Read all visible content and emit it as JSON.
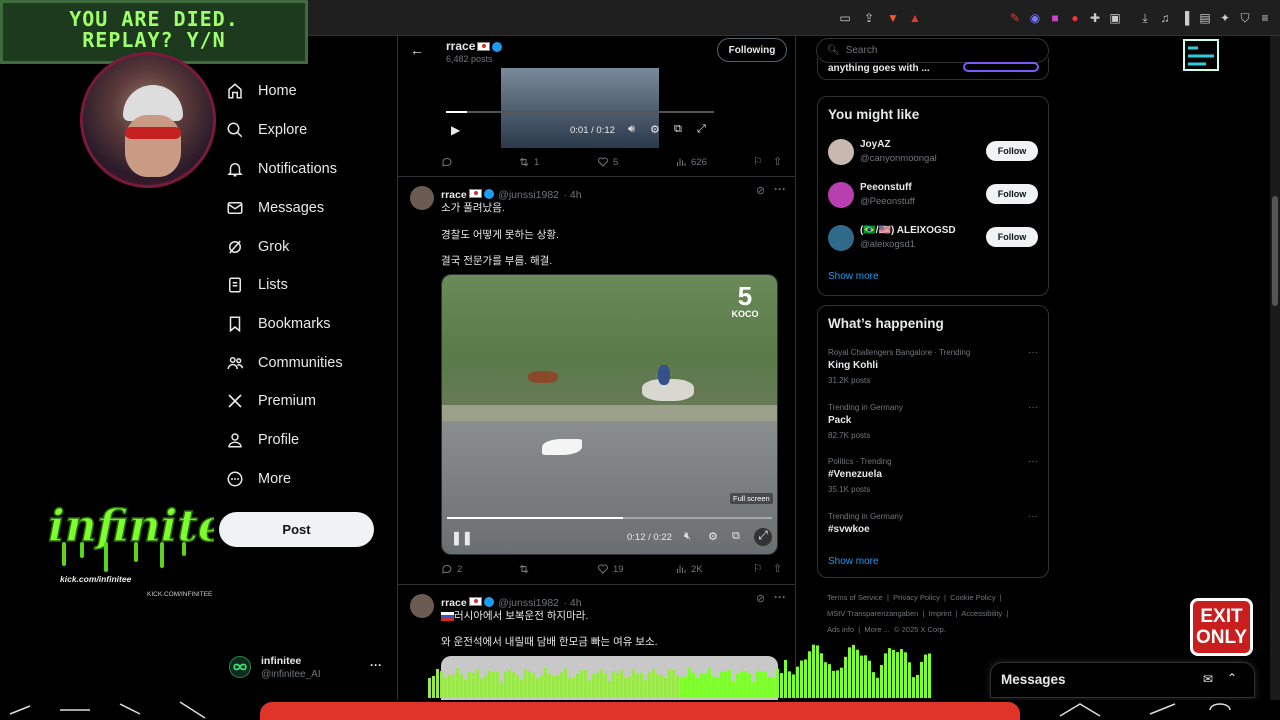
{
  "overlay": {
    "line1": "YOU ARE DIED.",
    "line2": "REPLAY? Y/N",
    "brand_text": "infinitee",
    "brand_sub": "kick.com/infinitee",
    "brand_url": "KICK.COM/INFINITEE",
    "exit_line1": "EXIT",
    "exit_line2": "ONLY",
    "colors": {
      "neon_green": "#7cff2a",
      "exit_red": "#c81e1e"
    }
  },
  "nav": {
    "items": [
      {
        "label": "Home",
        "icon": "home-icon"
      },
      {
        "label": "Explore",
        "icon": "search-icon"
      },
      {
        "label": "Notifications",
        "icon": "bell-icon"
      },
      {
        "label": "Messages",
        "icon": "mail-icon"
      },
      {
        "label": "Grok",
        "icon": "grok-icon"
      },
      {
        "label": "Lists",
        "icon": "list-icon"
      },
      {
        "label": "Bookmarks",
        "icon": "bookmark-icon"
      },
      {
        "label": "Communities",
        "icon": "people-icon"
      },
      {
        "label": "Premium",
        "icon": "x-logo-icon"
      },
      {
        "label": "Profile",
        "icon": "person-icon"
      },
      {
        "label": "More",
        "icon": "more-circle-icon"
      }
    ],
    "post_label": "Post",
    "account_name": "infinitee",
    "account_handle": "@infinitee_AI",
    "account_more": "···"
  },
  "timeline": {
    "header_name": "rrace",
    "header_posts": "6,482 posts",
    "following_label": "Following",
    "video1": {
      "time": "0:01 / 0:12",
      "progress": 0.08
    },
    "tweet0_actions": {
      "reply": "",
      "retweet": "1",
      "like": "5",
      "views": "626"
    },
    "tweet1": {
      "name": "rrace",
      "handle": "@junssi1982",
      "time": "· 4h",
      "line1": "소가 풀려났음.",
      "line2": "경찰도 어떻게 못하는 상황.",
      "line3": "결국 전문가를 부름. 해결.",
      "video_watermark": "KOCO",
      "video_tooltip": "Full screen",
      "video_time": "0:12 / 0:22",
      "progress": 0.54,
      "reply": "2",
      "retweet": "",
      "like": "19",
      "views": "2K"
    },
    "tweet2": {
      "name": "rrace",
      "handle": "@junssi1982",
      "time": "· 4h",
      "line1": "러시아에서 보복운전 하지마라.",
      "line2": "와 운전석에서 내릴때 담배 한모금 빠는 여유 보소."
    }
  },
  "right": {
    "search_placeholder": "Search",
    "top_snippet": "anything goes with ...",
    "you_might_like": "You might like",
    "suggestions": [
      {
        "name": "JoyAZ",
        "handle": "@canyonmoongal",
        "follow": "Follow",
        "avatar_color": "#c9b8b0"
      },
      {
        "name": "Peeonstuff",
        "handle": "@Peeonstuff",
        "follow": "Follow",
        "avatar_color": "#b83fb0"
      },
      {
        "name": "(🇧🇷/🇺🇸) ALEIXOGSD",
        "handle": "@aleixogsd1",
        "follow": "Follow",
        "avatar_color": "#2f6a8a"
      }
    ],
    "show_more": "Show more",
    "whats_happening": "What’s happening",
    "trends": [
      {
        "context": "Royal Challengers Bangalore · Trending",
        "title": "King Kohli",
        "posts": "31.2K posts"
      },
      {
        "context": "Trending in Germany",
        "title": "Pack",
        "posts": "82.7K posts"
      },
      {
        "context": "Politics · Trending",
        "title": "#Venezuela",
        "posts": "35.1K posts"
      },
      {
        "context": "Trending in Germany",
        "title": "#svwkoe",
        "posts": ""
      }
    ],
    "trend_more": "···",
    "show_more_2": "Show more",
    "footer": {
      "l1": "Terms of Service",
      "l2": "Privacy Policy",
      "l3": "Cookie Policy",
      "l4": "MStV Transparenzangaben",
      "l5": "Imprint",
      "l6": "Accessibility",
      "l7": "Ads info",
      "l8": "More ...",
      "l9": "© 2025 X Corp."
    },
    "messages_label": "Messages"
  }
}
